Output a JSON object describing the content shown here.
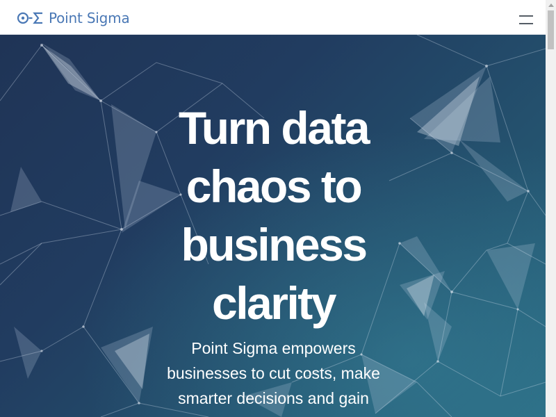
{
  "header": {
    "brand_name": "Point Sigma",
    "brand_logo_icon": "circle-dot-dash-sigma-icon",
    "menu_icon": "hamburger-menu-icon"
  },
  "hero": {
    "title": "Turn data chaos to business clarity",
    "subtitle": "Point Sigma empowers businesses to cut costs, make smarter decisions and gain"
  },
  "colors": {
    "brand_blue": "#4a78b5",
    "hero_dark": "#1f3456",
    "hero_teal": "#2a6a82",
    "text_light": "#ffffff"
  }
}
